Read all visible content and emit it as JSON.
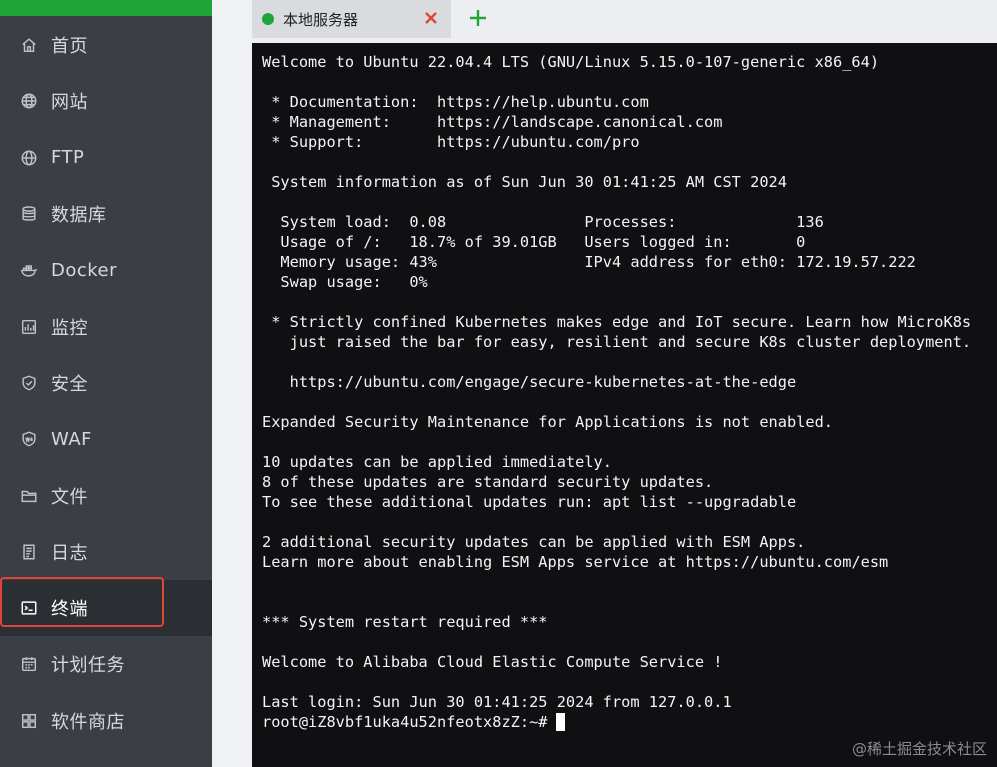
{
  "sidebar": {
    "items": [
      {
        "label": "首页",
        "icon": "home-icon"
      },
      {
        "label": "网站",
        "icon": "globe-icon"
      },
      {
        "label": "FTP",
        "icon": "globe-icon"
      },
      {
        "label": "数据库",
        "icon": "database-icon"
      },
      {
        "label": "Docker",
        "icon": "docker-icon"
      },
      {
        "label": "监控",
        "icon": "monitor-chart-icon"
      },
      {
        "label": "安全",
        "icon": "shield-icon"
      },
      {
        "label": "WAF",
        "icon": "waf-shield-icon"
      },
      {
        "label": "文件",
        "icon": "folder-icon"
      },
      {
        "label": "日志",
        "icon": "log-file-icon"
      },
      {
        "label": "终端",
        "icon": "terminal-icon",
        "active": true
      },
      {
        "label": "计划任务",
        "icon": "calendar-icon"
      },
      {
        "label": "软件商店",
        "icon": "grid-apps-icon"
      }
    ]
  },
  "tabs": {
    "active_tab": {
      "label": "本地服务器",
      "status_color": "#20a53a"
    },
    "close_icon": "close-icon",
    "add_icon": "plus-icon"
  },
  "terminal": {
    "output": "Welcome to Ubuntu 22.04.4 LTS (GNU/Linux 5.15.0-107-generic x86_64)\n\n * Documentation:  https://help.ubuntu.com\n * Management:     https://landscape.canonical.com\n * Support:        https://ubuntu.com/pro\n\n System information as of Sun Jun 30 01:41:25 AM CST 2024\n\n  System load:  0.08               Processes:             136\n  Usage of /:   18.7% of 39.01GB   Users logged in:       0\n  Memory usage: 43%                IPv4 address for eth0: 172.19.57.222\n  Swap usage:   0%\n\n * Strictly confined Kubernetes makes edge and IoT secure. Learn how MicroK8s\n   just raised the bar for easy, resilient and secure K8s cluster deployment.\n\n   https://ubuntu.com/engage/secure-kubernetes-at-the-edge\n\nExpanded Security Maintenance for Applications is not enabled.\n\n10 updates can be applied immediately.\n8 of these updates are standard security updates.\nTo see these additional updates run: apt list --upgradable\n\n2 additional security updates can be applied with ESM Apps.\nLearn more about enabling ESM Apps service at https://ubuntu.com/esm\n\n\n*** System restart required ***\n\nWelcome to Alibaba Cloud Elastic Compute Service !\n\nLast login: Sun Jun 30 01:41:25 2024 from 127.0.0.1",
    "prompt": "root@iZ8vbf1uka4u52nfeotx8zZ:~#"
  },
  "watermark": "@稀土掘金技术社区",
  "colors": {
    "accent": "#20a53a",
    "highlight": "#e0443a",
    "sidebar_bg": "#3b3f45",
    "terminal_bg": "#101012"
  }
}
